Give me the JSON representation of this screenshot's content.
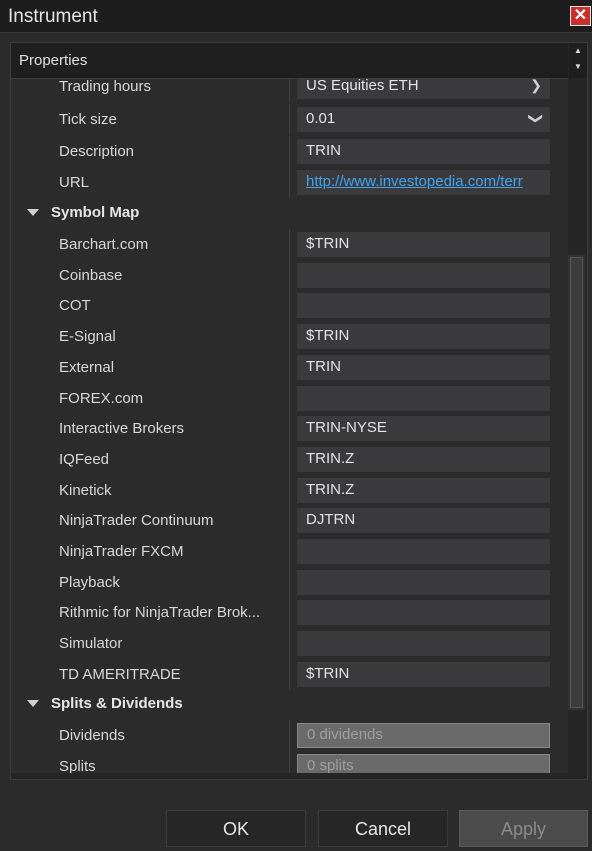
{
  "window": {
    "title": "Instrument",
    "close_label": "✕"
  },
  "panel": {
    "header": "Properties",
    "scroll_up": "▲",
    "scroll_down": "▼"
  },
  "top_rows": [
    {
      "label": "Trading hours",
      "value": "US Equities ETH",
      "type": "dropdown"
    },
    {
      "label": "Tick size",
      "value": "0.01",
      "type": "dropdown"
    },
    {
      "label": "Description",
      "value": "TRIN",
      "type": "text"
    },
    {
      "label": "URL",
      "value": "http://www.investopedia.com/terr",
      "type": "link"
    }
  ],
  "symbol_map": {
    "title": "Symbol Map",
    "rows": [
      {
        "label": "Barchart.com",
        "value": "$TRIN"
      },
      {
        "label": "Coinbase",
        "value": ""
      },
      {
        "label": "COT",
        "value": ""
      },
      {
        "label": "E-Signal",
        "value": "$TRIN"
      },
      {
        "label": "External",
        "value": "TRIN"
      },
      {
        "label": "FOREX.com",
        "value": ""
      },
      {
        "label": "Interactive Brokers",
        "value": "TRIN-NYSE"
      },
      {
        "label": "IQFeed",
        "value": "TRIN.Z"
      },
      {
        "label": "Kinetick",
        "value": "TRIN.Z"
      },
      {
        "label": "NinjaTrader Continuum",
        "value": "DJTRN"
      },
      {
        "label": "NinjaTrader FXCM",
        "value": ""
      },
      {
        "label": "Playback",
        "value": ""
      },
      {
        "label": "Rithmic for NinjaTrader Brok...",
        "value": ""
      },
      {
        "label": "Simulator",
        "value": ""
      },
      {
        "label": "TD AMERITRADE",
        "value": "$TRIN"
      }
    ]
  },
  "splits_dividends": {
    "title": "Splits & Dividends",
    "rows": [
      {
        "label": "Dividends",
        "value": "0 dividends"
      },
      {
        "label": "Splits",
        "value": "0 splits"
      }
    ]
  },
  "buttons": {
    "ok": "OK",
    "cancel": "Cancel",
    "apply": "Apply"
  }
}
